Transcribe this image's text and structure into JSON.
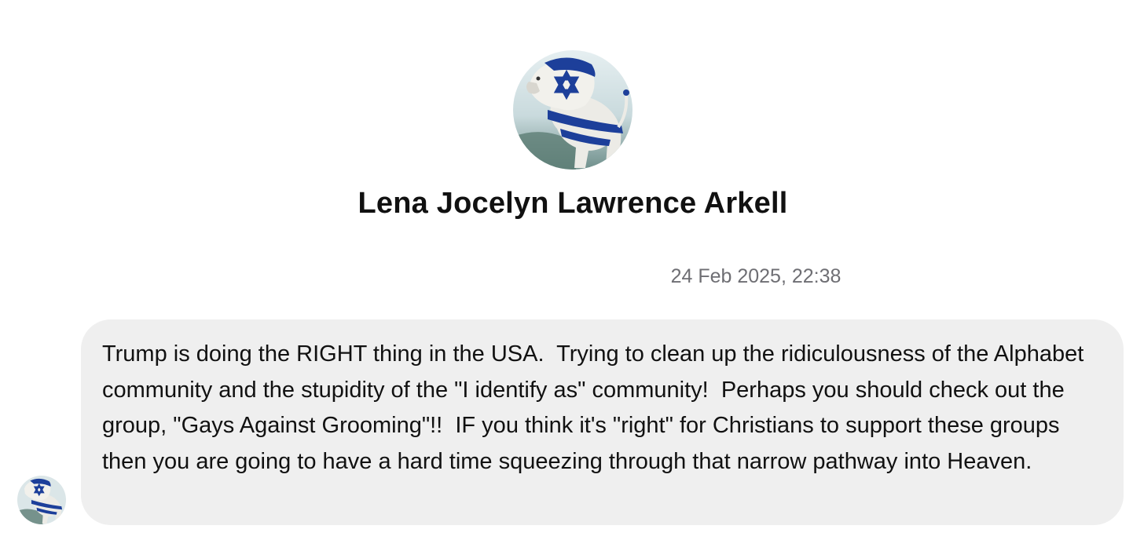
{
  "contact": {
    "name": "Lena Jocelyn Lawrence Arkell",
    "avatar_icon": "lion-flag-avatar-icon"
  },
  "conversation": {
    "timestamp": "24 Feb 2025, 22:38",
    "messages": [
      {
        "direction": "incoming",
        "text": "Trump is doing the RIGHT thing in the USA.  Trying to clean up the ridiculousness of the Alphabet community and the stupidity of the \"I identify as\" community!  Perhaps you should check out the group, \"Gays Against Grooming\"!!  IF you think it's \"right\" for Christians to support these groups then you are going to have a hard time squeezing through that narrow pathway into Heaven."
      }
    ]
  },
  "colors": {
    "bubble_background": "#efefef",
    "timestamp_text": "#6e6e73",
    "flag_blue": "#1d3f9a"
  }
}
